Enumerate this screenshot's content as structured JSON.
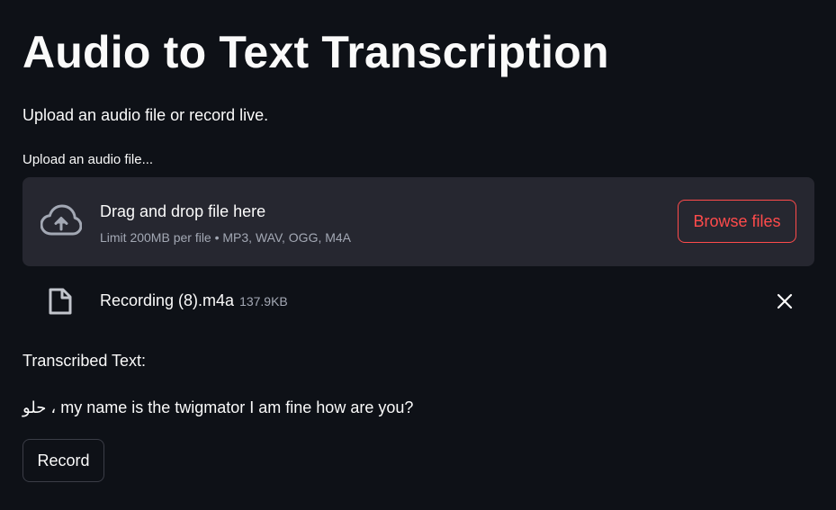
{
  "header": {
    "title": "Audio to Text Transcription",
    "subtitle": "Upload an audio file or record live."
  },
  "uploader": {
    "label": "Upload an audio file...",
    "instructions": "Drag and drop file here",
    "limit_text": "Limit 200MB per file • MP3, WAV, OGG, M4A",
    "browse_label": "Browse files",
    "icon": "cloud-upload-icon"
  },
  "uploaded_file": {
    "name": "Recording (8).m4a",
    "size": "137.9KB",
    "icon": "file-icon",
    "remove_icon": "close-icon"
  },
  "transcription": {
    "label": "Transcribed Text:",
    "text": "حلو ، my name is the twigmator I am fine how are you?"
  },
  "controls": {
    "record_label": "Record"
  },
  "colors": {
    "background": "#0e1117",
    "surface": "#262730",
    "accent": "#ff4b4b",
    "text": "#fafafa",
    "muted_text": "#a3a8b4"
  }
}
